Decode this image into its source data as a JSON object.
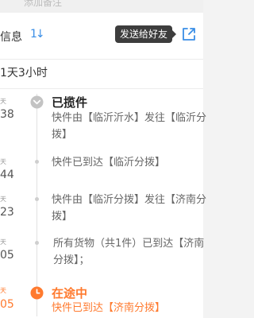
{
  "top": {
    "clipped_text": "添加备注"
  },
  "header": {
    "title": "信息",
    "sort_icon": "sort-arrows-icon"
  },
  "tooltip": {
    "text": "发送给好友"
  },
  "share": {
    "icon": "share-out-icon"
  },
  "duration": {
    "text": "1天3小时"
  },
  "events": [
    {
      "date": "天",
      "time": "38",
      "status": "已揽件",
      "desc": "快件由【临沂沂水】发往【临沂分拨】"
    },
    {
      "date": "天",
      "time": "44",
      "desc": "快件已到达【临沂分拨】"
    },
    {
      "date": "天",
      "time": "23",
      "desc": "快件由【临沂分拨】发往【济南分拨】"
    },
    {
      "date": "天",
      "time": "05",
      "desc": "所有货物（共1件）已到达【济南分拨】；"
    },
    {
      "date": "天",
      "time": "05",
      "status": "在途中",
      "desc": "快件已到达【济南分拨】"
    }
  ],
  "colors": {
    "accent": "#3a8ee6",
    "active": "#ff7a2e",
    "tooltip_bg": "#3d3d3d"
  }
}
